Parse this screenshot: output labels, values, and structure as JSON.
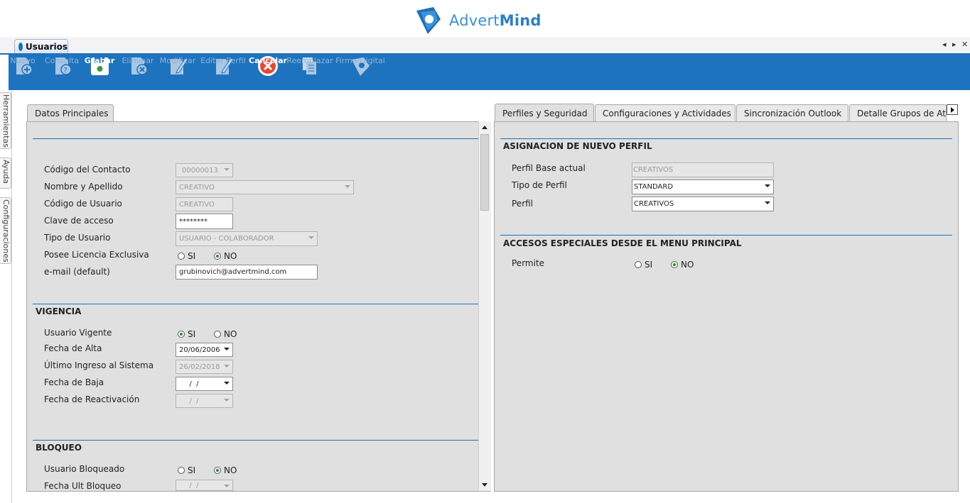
{
  "brand": {
    "name_regular": "Advert",
    "name_bold": "Mind",
    "color": "#2d7fc6"
  },
  "doc_tab": {
    "label": "Usuarios"
  },
  "window_controls": {
    "prev": "◂",
    "next": "▸",
    "close": "✕"
  },
  "toolbar": {
    "color": "#1e73be",
    "buttons": [
      {
        "label": "Nuevo",
        "icon": "new-doc-icon",
        "enabled": false
      },
      {
        "label": "Consulta",
        "icon": "query-doc-icon",
        "enabled": false
      },
      {
        "label": "Grabar",
        "icon": "save-icon",
        "enabled": true
      },
      {
        "label": "Eliminar",
        "icon": "delete-doc-icon",
        "enabled": false
      },
      {
        "label": "Modificar",
        "icon": "edit-doc-icon",
        "enabled": false
      },
      {
        "label": "Editar Perfil",
        "icon": "edit-profile-icon",
        "enabled": false
      },
      {
        "label": "Cancelar",
        "icon": "cancel-icon",
        "enabled": true
      },
      {
        "label": "Reemplazar",
        "icon": "replace-icon",
        "enabled": false
      },
      {
        "label": "Firma Digital",
        "icon": "digital-signature-icon",
        "enabled": false
      }
    ]
  },
  "side_tabs": [
    "Herramientas",
    "Ayuda",
    "Configuraciones"
  ],
  "left_panel": {
    "tab": "Datos Principales",
    "fields": {
      "codigo_contacto": {
        "label": "Código del Contacto",
        "value": "00000013"
      },
      "nombre": {
        "label": "Nombre y Apellido",
        "value": "CREATIVO"
      },
      "codigo_usuario": {
        "label": "Código de Usuario",
        "value": "CREATIVO"
      },
      "clave": {
        "label": "Clave de acceso",
        "value": "********"
      },
      "tipo_usuario": {
        "label": "Tipo de Usuario",
        "value": "USUARIO - COLABORADOR"
      },
      "licencia": {
        "label": "Posee Licencia Exclusiva",
        "selected": "NO"
      },
      "email": {
        "label": "e-mail (default)",
        "value": "grubinovich@advertmind.com"
      }
    },
    "vigencia": {
      "title": "VIGENCIA",
      "usuario_vigente": {
        "label": "Usuario Vigente",
        "selected": "SI"
      },
      "fecha_alta": {
        "label": "Fecha de Alta",
        "value": "20/06/2006"
      },
      "ultimo_ingreso": {
        "label": "Último Ingreso al Sistema",
        "value": "26/02/2018"
      },
      "fecha_baja": {
        "label": "Fecha de Baja",
        "value": "  /  /"
      },
      "fecha_reactivacion": {
        "label": "Fecha de Reactivación",
        "value": "  /  /"
      }
    },
    "bloqueo": {
      "title": "BLOQUEO",
      "usuario_bloqueado": {
        "label": "Usuario Bloqueado",
        "selected": "NO"
      },
      "fecha_ult_bloqueo": {
        "label": "Fecha Ult Bloqueo",
        "value": "  /  /"
      }
    }
  },
  "radio_labels": {
    "si": "SI",
    "no": "NO"
  },
  "right_panel": {
    "tabs": [
      "Perfiles y Seguridad",
      "Configuraciones y Actividades",
      "Sincronización Outlook",
      "Detalle Grupos de Ate"
    ],
    "asignacion": {
      "title": "ASIGNACION DE NUEVO PERFIL",
      "perfil_base": {
        "label": "Perfil Base actual",
        "value": "CREATIVOS"
      },
      "tipo_perfil": {
        "label": "Tipo de Perfil",
        "value": "STANDARD"
      },
      "perfil": {
        "label": "Perfil",
        "value": "CREATIVOS"
      }
    },
    "accesos": {
      "title": "ACCESOS ESPECIALES DESDE EL MENU PRINCIPAL",
      "permite": {
        "label": "Permite",
        "selected": "NO"
      }
    }
  }
}
